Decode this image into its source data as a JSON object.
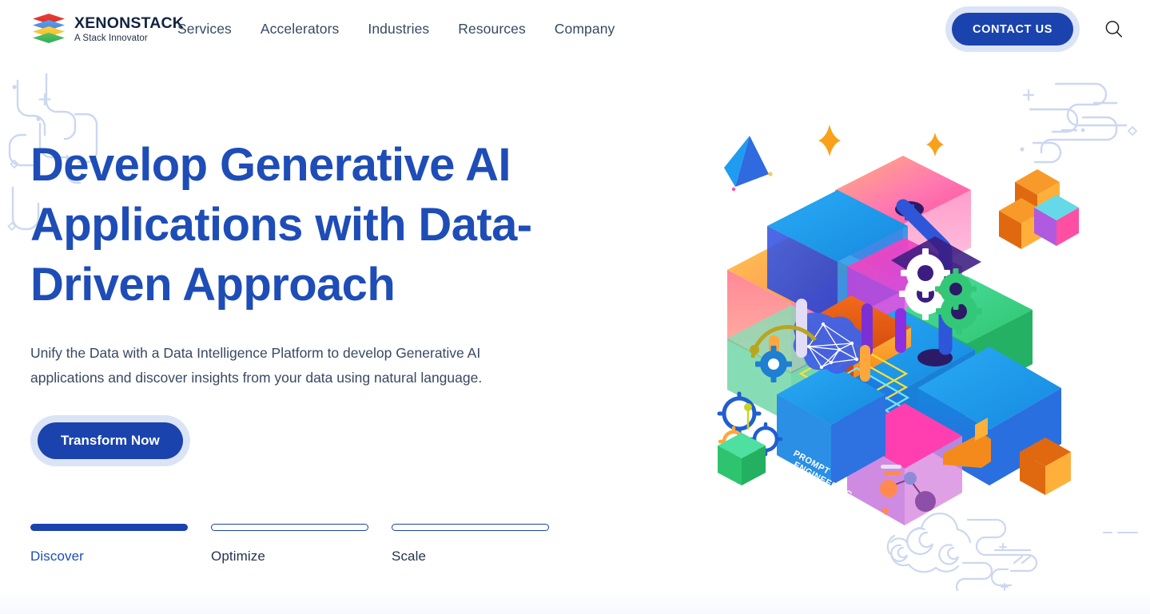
{
  "header": {
    "logo": {
      "name": "XENONSTACK",
      "tagline": "A Stack Innovator",
      "layer_colors": [
        "#ef3b33",
        "#5e9bea",
        "#ffd040",
        "#53c46b"
      ]
    },
    "nav_items": [
      {
        "label": "Services"
      },
      {
        "label": "Accelerators"
      },
      {
        "label": "Industries"
      },
      {
        "label": "Resources"
      },
      {
        "label": "Company"
      }
    ],
    "cta": {
      "label": "CONTACT US",
      "bg": "#1a43ae",
      "halo": "#dbe4f7",
      "text_color": "#ffffff"
    },
    "search_icon": "search-icon",
    "nav_text_color": "#364a63"
  },
  "hero": {
    "title": "Develop Generative AI Applications with Data-Driven Approach",
    "title_color": "#1e4db7",
    "subtitle": "Unify the Data with a Data Intelligence Platform to develop Generative AI applications and discover insights from your data using natural language.",
    "subtitle_color": "#384963",
    "primary_button": {
      "label": "Transform Now",
      "bg": "#1a43ae",
      "halo": "#dbe4f7"
    },
    "steps": [
      {
        "label": "Discover",
        "active": true
      },
      {
        "label": "Optimize",
        "active": false
      },
      {
        "label": "Scale",
        "active": false
      }
    ],
    "illustration": {
      "name": "isometric-genai-blocks-illustration",
      "embedded_text": [
        "PROMPT",
        "ENGINEERING"
      ],
      "accent_colors": [
        "#1f9cf0",
        "#ff5ab0",
        "#ffb03a",
        "#32c878",
        "#f26a1b",
        "#7b2fd4",
        "#2a50d8"
      ]
    },
    "decorations": {
      "line_art_color": "#ccd7f0",
      "items": [
        "top-left-tube-lines",
        "top-right-tube-lines",
        "bottom-right-cloud-swirls"
      ]
    }
  }
}
